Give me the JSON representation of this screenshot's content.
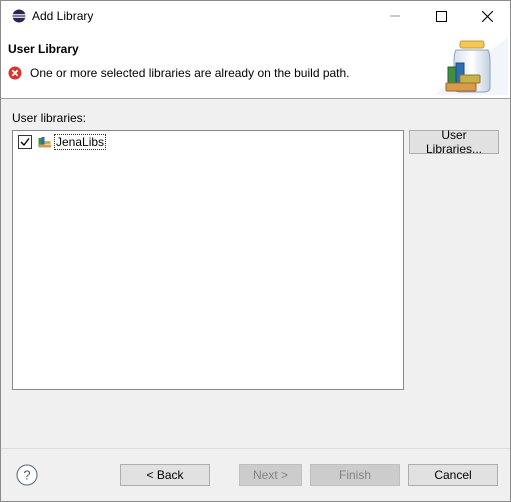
{
  "window": {
    "title": "Add Library"
  },
  "header": {
    "title": "User Library",
    "message": "One or more selected libraries are already on the build path."
  },
  "section": {
    "label": "User libraries:"
  },
  "libraries": [
    {
      "name": "JenaLibs",
      "checked": true
    }
  ],
  "buttons": {
    "user_libraries": "User Libraries...",
    "back": "< Back",
    "next": "Next >",
    "finish": "Finish",
    "cancel": "Cancel"
  },
  "colors": {
    "error": "#d9342b",
    "accent": "#0078d7"
  }
}
